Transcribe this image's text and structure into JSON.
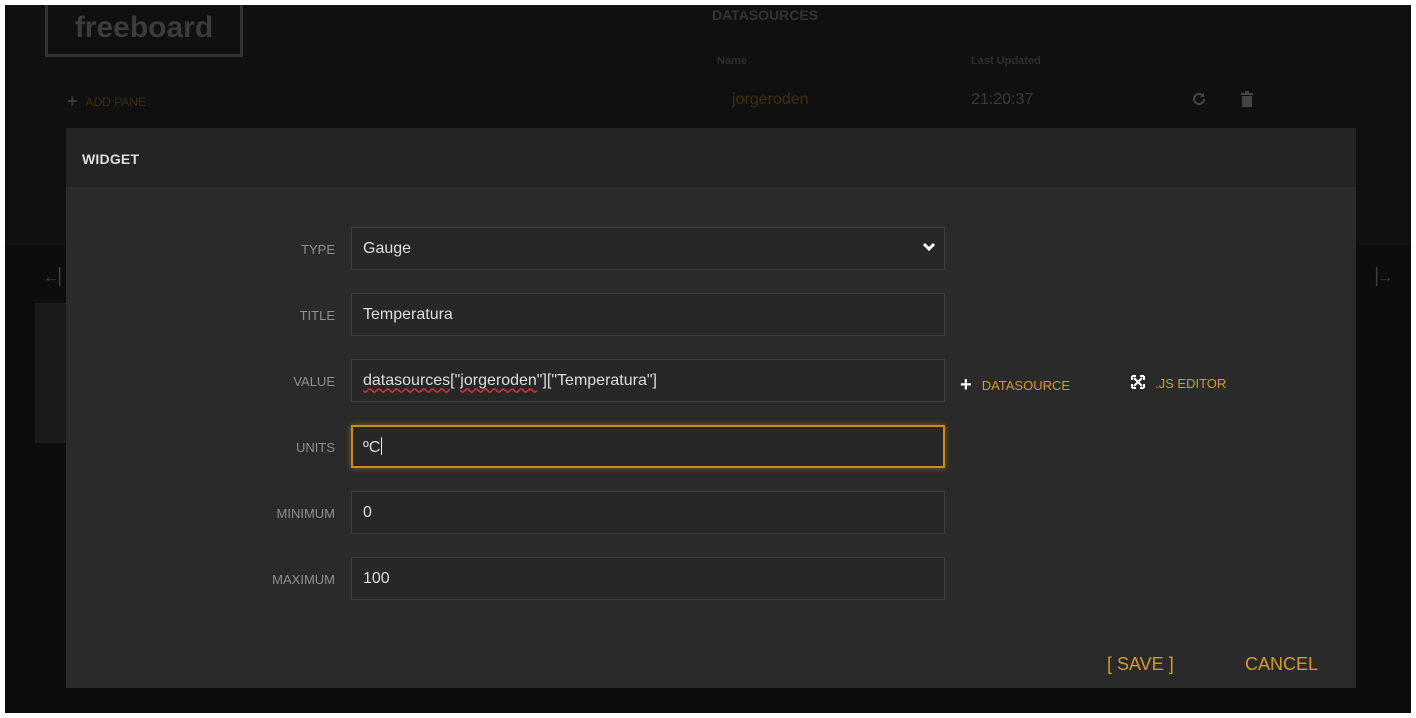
{
  "app": {
    "logo": "freeboard",
    "add_pane_label": "ADD PANE"
  },
  "datasources": {
    "title": "DATASOURCES",
    "columns": [
      "Name",
      "Last Updated"
    ],
    "rows": [
      {
        "name": "jorgeroden",
        "last_updated": "21:20:37"
      }
    ]
  },
  "modal": {
    "title": "WIDGET",
    "fields": {
      "type": {
        "label": "TYPE",
        "value": "Gauge"
      },
      "title": {
        "label": "TITLE",
        "value": "Temperatura"
      },
      "value": {
        "label": "VALUE",
        "value": "datasources[\"jorgeroden\"][\"Temperatura\"]",
        "prefix": "datasources[\"",
        "spell1": "datasources",
        "mid": "[\"",
        "spell2": "jorgeroden",
        "suffix": "\"][\"Temperatura\"]"
      },
      "units": {
        "label": "UNITS",
        "value": "ºC"
      },
      "minimum": {
        "label": "MINIMUM",
        "value": "0"
      },
      "maximum": {
        "label": "MAXIMUM",
        "value": "100"
      }
    },
    "actions": {
      "datasource": "DATASOURCE",
      "js_editor": ".JS EDITOR"
    },
    "buttons": {
      "save": "[ SAVE ]",
      "cancel": "CANCEL"
    }
  },
  "colors": {
    "accent": "#d49a2c",
    "focus_border": "#c98a28",
    "modal_bg": "#2a2a2a",
    "page_bg": "#0d0d0d"
  },
  "icons": [
    "plus-icon",
    "refresh-icon",
    "trash-icon",
    "chevron-down-icon",
    "expand-icon",
    "arrow-left-icon",
    "arrow-right-icon"
  ]
}
